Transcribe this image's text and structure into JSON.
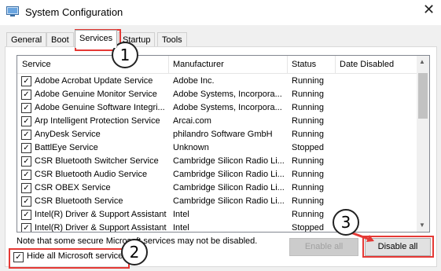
{
  "window": {
    "title": "System Configuration"
  },
  "tabs": [
    "General",
    "Boot",
    "Services",
    "Startup",
    "Tools"
  ],
  "columns": [
    "Service",
    "Manufacturer",
    "Status",
    "Date Disabled"
  ],
  "rows": [
    {
      "service": "Adobe Acrobat Update Service",
      "manufacturer": "Adobe Inc.",
      "status": "Running",
      "checked": true
    },
    {
      "service": "Adobe Genuine Monitor Service",
      "manufacturer": "Adobe Systems, Incorpora...",
      "status": "Running",
      "checked": true
    },
    {
      "service": "Adobe Genuine Software Integri...",
      "manufacturer": "Adobe Systems, Incorpora...",
      "status": "Running",
      "checked": true
    },
    {
      "service": "Arp Intelligent Protection Service",
      "manufacturer": "Arcai.com",
      "status": "Running",
      "checked": true
    },
    {
      "service": "AnyDesk Service",
      "manufacturer": "philandro Software GmbH",
      "status": "Running",
      "checked": true
    },
    {
      "service": "BattlEye Service",
      "manufacturer": "Unknown",
      "status": "Stopped",
      "checked": true
    },
    {
      "service": "CSR Bluetooth Switcher Service",
      "manufacturer": "Cambridge Silicon Radio Li...",
      "status": "Running",
      "checked": true
    },
    {
      "service": "CSR Bluetooth Audio Service",
      "manufacturer": "Cambridge Silicon Radio Li...",
      "status": "Running",
      "checked": true
    },
    {
      "service": "CSR OBEX Service",
      "manufacturer": "Cambridge Silicon Radio Li...",
      "status": "Running",
      "checked": true
    },
    {
      "service": "CSR Bluetooth Service",
      "manufacturer": "Cambridge Silicon Radio Li...",
      "status": "Running",
      "checked": true
    },
    {
      "service": "Intel(R) Driver & Support Assistant",
      "manufacturer": "Intel",
      "status": "Running",
      "checked": true
    },
    {
      "service": "Intel(R) Driver & Support Assistant",
      "manufacturer": "Intel",
      "status": "Stopped",
      "checked": true
    }
  ],
  "note": "Note that some secure Microsoft services may not be disabled.",
  "hide_ms": {
    "label": "Hide all Microsoft services",
    "checked": true
  },
  "buttons": {
    "enable_all": "Enable all",
    "disable_all": "Disable all"
  },
  "callouts": [
    "1",
    "2",
    "3"
  ],
  "colors": {
    "highlight": "#e53935",
    "accent_arrow": "#e53935"
  }
}
